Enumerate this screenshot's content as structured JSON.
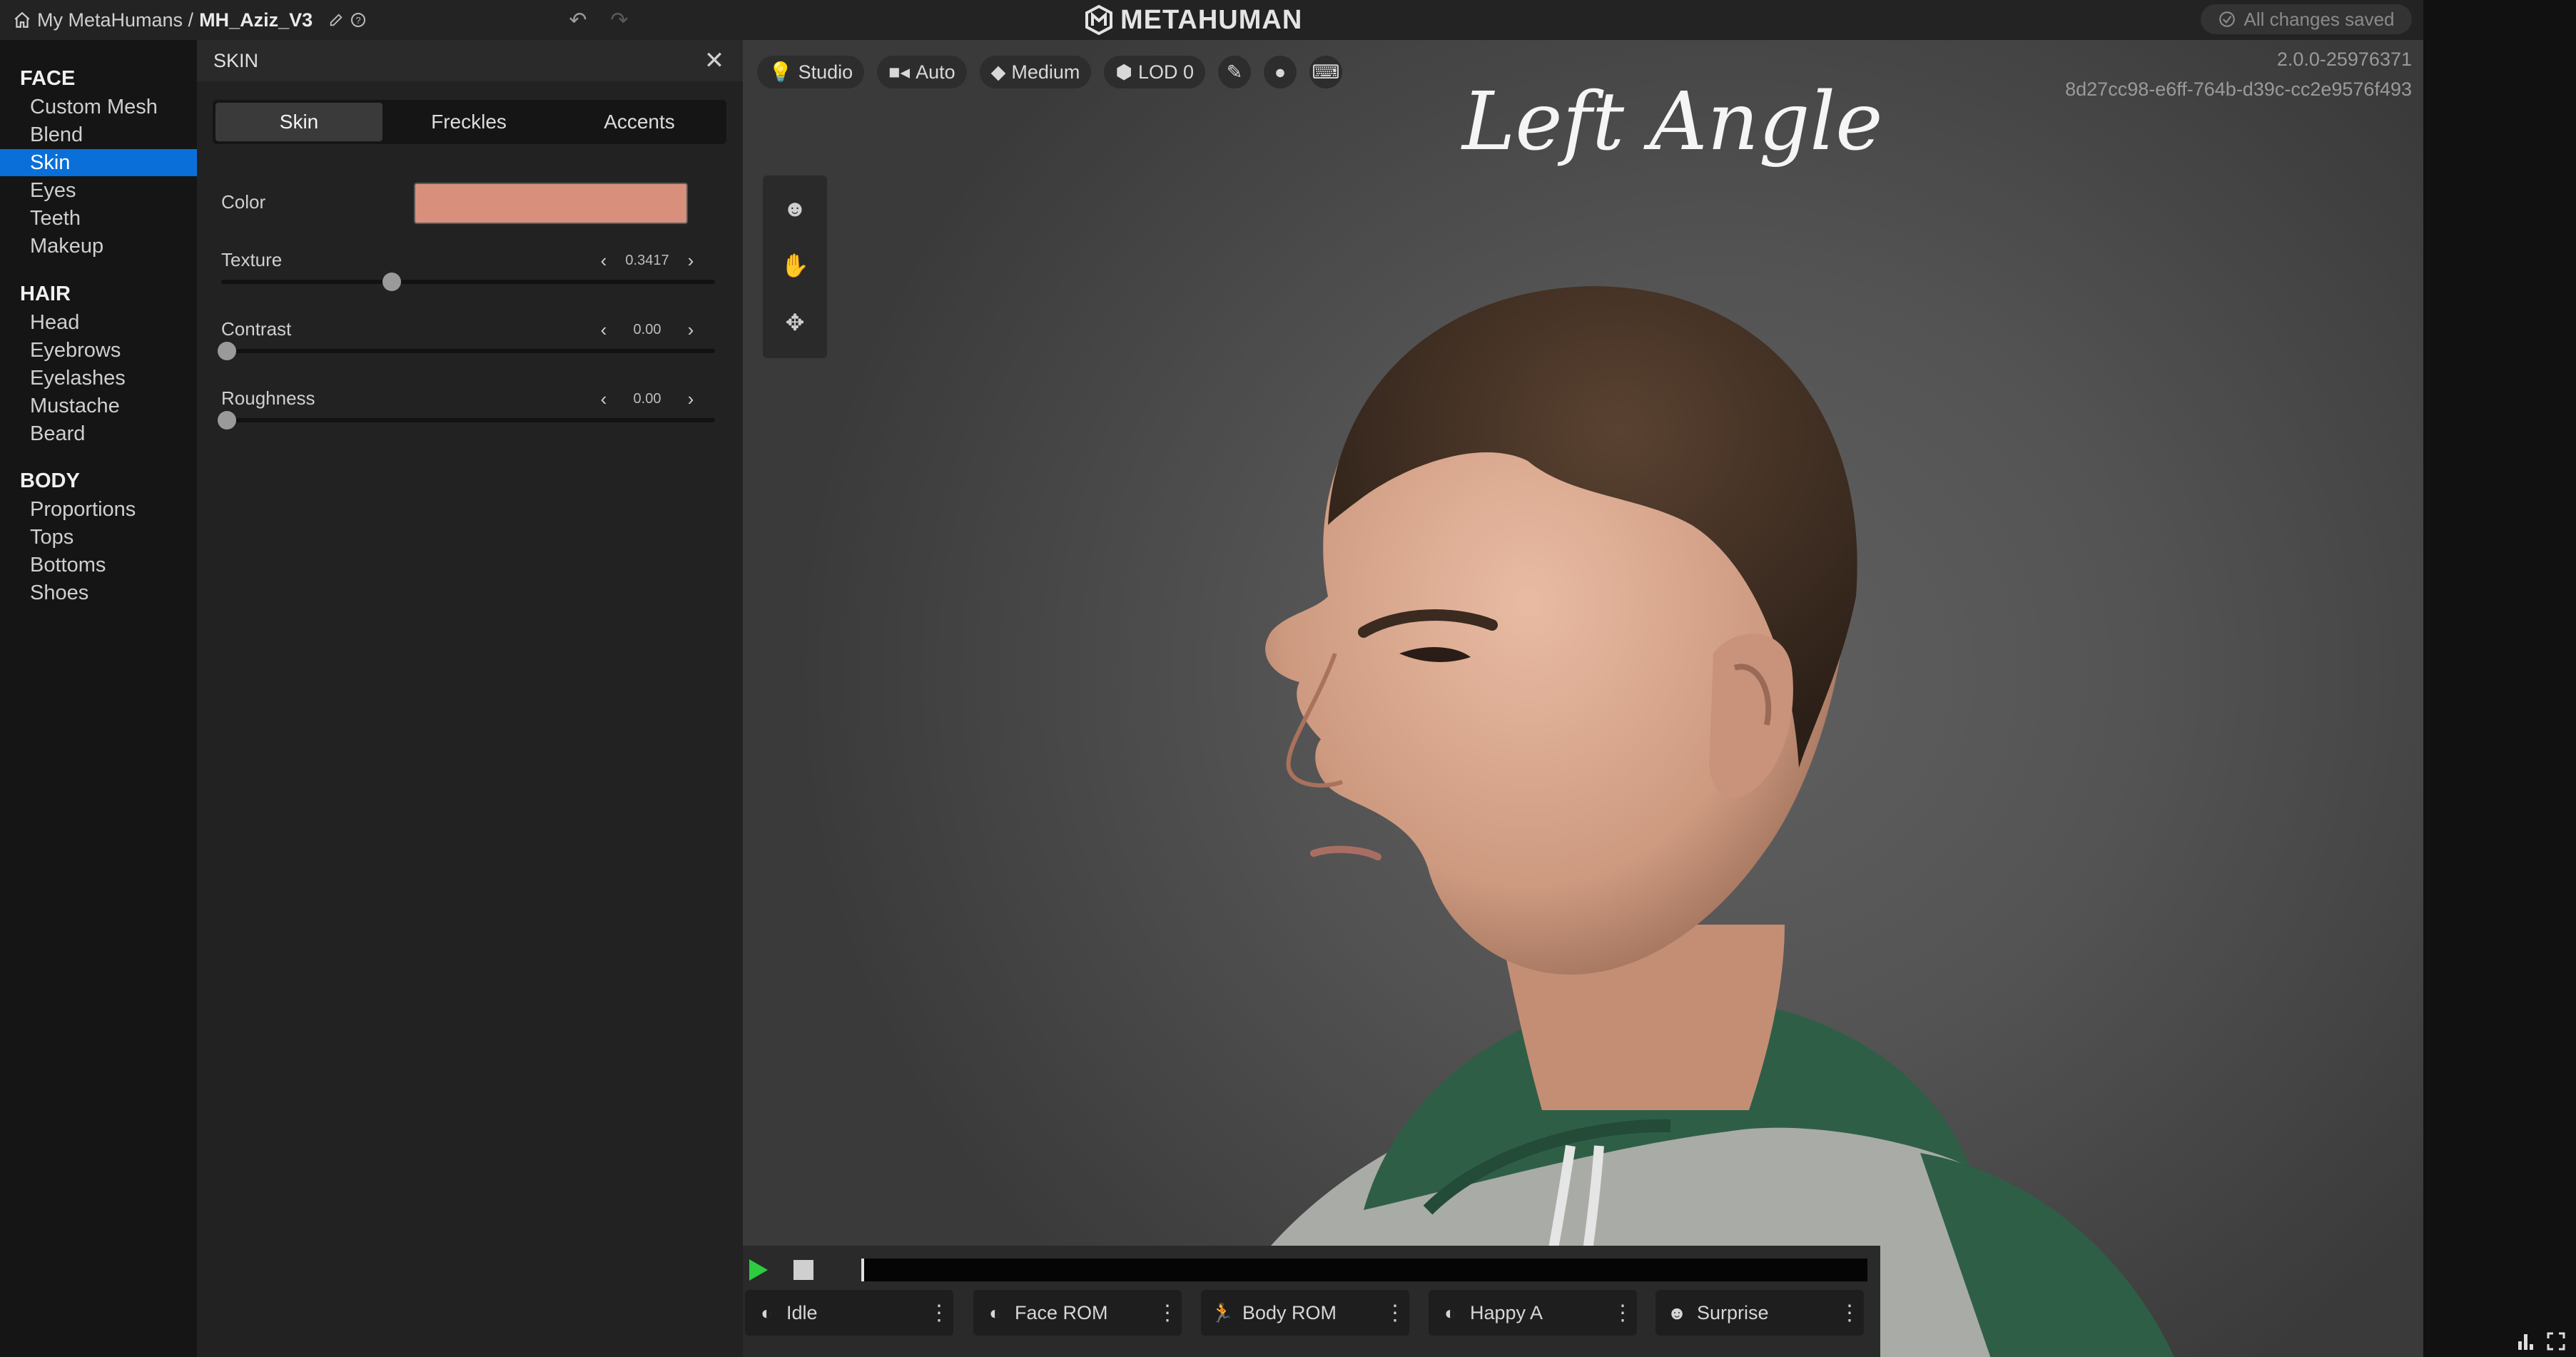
{
  "topbar": {
    "breadcrumb_root": "My MetaHumans /",
    "current": "MH_Aziz_V3",
    "logo": "METAHUMAN",
    "saved_status": "All changes saved"
  },
  "nav": {
    "face_header": "FACE",
    "face_items": [
      "Custom Mesh",
      "Blend",
      "Skin",
      "Eyes",
      "Teeth",
      "Makeup"
    ],
    "hair_header": "HAIR",
    "hair_items": [
      "Head",
      "Eyebrows",
      "Eyelashes",
      "Mustache",
      "Beard"
    ],
    "body_header": "BODY",
    "body_items": [
      "Proportions",
      "Tops",
      "Bottoms",
      "Shoes"
    ],
    "selected": "Skin"
  },
  "panel": {
    "title": "SKIN",
    "tabs": [
      "Skin",
      "Freckles",
      "Accents"
    ],
    "active_tab": "Skin",
    "color_label": "Color",
    "color_value": "#d8907c",
    "texture": {
      "label": "Texture",
      "value": "0.3417",
      "fraction": 0.3417
    },
    "contrast": {
      "label": "Contrast",
      "value": "0.00",
      "fraction": 0
    },
    "roughness": {
      "label": "Roughness",
      "value": "0.00",
      "fraction": 0
    }
  },
  "viewport": {
    "toolbar": {
      "lighting": "Studio",
      "camera": "Auto",
      "quality": "Medium",
      "lod": "LOD 0"
    },
    "version": "2.0.0-25976371",
    "build_hash": "8d27cc98-e6ff-764b-d39c-cc2e9576f493",
    "overlay_title": "Left Angle"
  },
  "playback": {
    "animations": [
      "Idle",
      "Face ROM",
      "Body ROM",
      "Happy A",
      "Surprise"
    ]
  },
  "colors": {
    "accent": "#0a6fd8",
    "play": "#2ecc40",
    "hoodie": "#2f5e47",
    "sleeve": "#a9aba6"
  }
}
